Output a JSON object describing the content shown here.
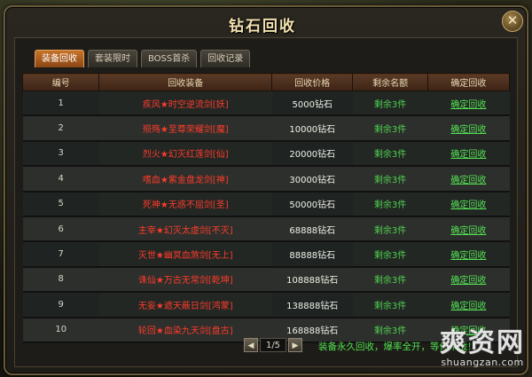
{
  "window": {
    "title": "钻石回收"
  },
  "tabs": [
    {
      "label": "装备回收",
      "active": true
    },
    {
      "label": "套装限时",
      "active": false
    },
    {
      "label": "BOSS首杀",
      "active": false
    },
    {
      "label": "回收记录",
      "active": false
    }
  ],
  "table": {
    "headers": [
      "编号",
      "回收装备",
      "回收价格",
      "剩余名额",
      "确定回收"
    ],
    "rows": [
      {
        "id": "1",
        "item": "疾风★时空逆流剑[妖]",
        "price": "5000钻石",
        "remaining": "剩余3件",
        "action": "确定回收"
      },
      {
        "id": "2",
        "item": "殒殇★至尊荣耀剑[魔]",
        "price": "10000钻石",
        "remaining": "剩余3件",
        "action": "确定回收"
      },
      {
        "id": "3",
        "item": "烈火★幻灭红莲剑[仙]",
        "price": "20000钻石",
        "remaining": "剩余3件",
        "action": "确定回收"
      },
      {
        "id": "4",
        "item": "嗜血★紫金盘龙剑[神]",
        "price": "30000钻石",
        "remaining": "剩余3件",
        "action": "确定回收"
      },
      {
        "id": "5",
        "item": "死神★无惑不屈剑[圣]",
        "price": "50000钻石",
        "remaining": "剩余3件",
        "action": "确定回收"
      },
      {
        "id": "6",
        "item": "主宰★幻灭太虚剑[不灭]",
        "price": "68888钻石",
        "remaining": "剩余3件",
        "action": "确定回收"
      },
      {
        "id": "7",
        "item": "灭世★幽冥血煞剑[无上]",
        "price": "88888钻石",
        "remaining": "剩余3件",
        "action": "确定回收"
      },
      {
        "id": "8",
        "item": "诛仙★万古无常剑[乾坤]",
        "price": "108888钻石",
        "remaining": "剩余3件",
        "action": "确定回收"
      },
      {
        "id": "9",
        "item": "无妄★遮天蔽日剑[鸿蒙]",
        "price": "138888钻石",
        "remaining": "剩余3件",
        "action": "确定回收"
      },
      {
        "id": "10",
        "item": "轮回★血染九天剑[盘古]",
        "price": "168888钻石",
        "remaining": "剩余3件",
        "action": "确定回收"
      }
    ]
  },
  "pager": {
    "prev": "◀",
    "page": "1/5",
    "next": "▶"
  },
  "notice": "装备永久回收，爆率全开，等你来战！",
  "watermark": {
    "logo": "爽资网",
    "url": "shuangzan.com"
  },
  "icons": {
    "close": "close-icon",
    "prev": "arrow-left-icon",
    "next": "arrow-right-icon"
  },
  "colors": {
    "item_name": "#ff3c2c",
    "remaining": "#4fd04f",
    "action_link": "#55e255",
    "active_tab": "#c8742a",
    "header_bg": "#5b3a26"
  }
}
